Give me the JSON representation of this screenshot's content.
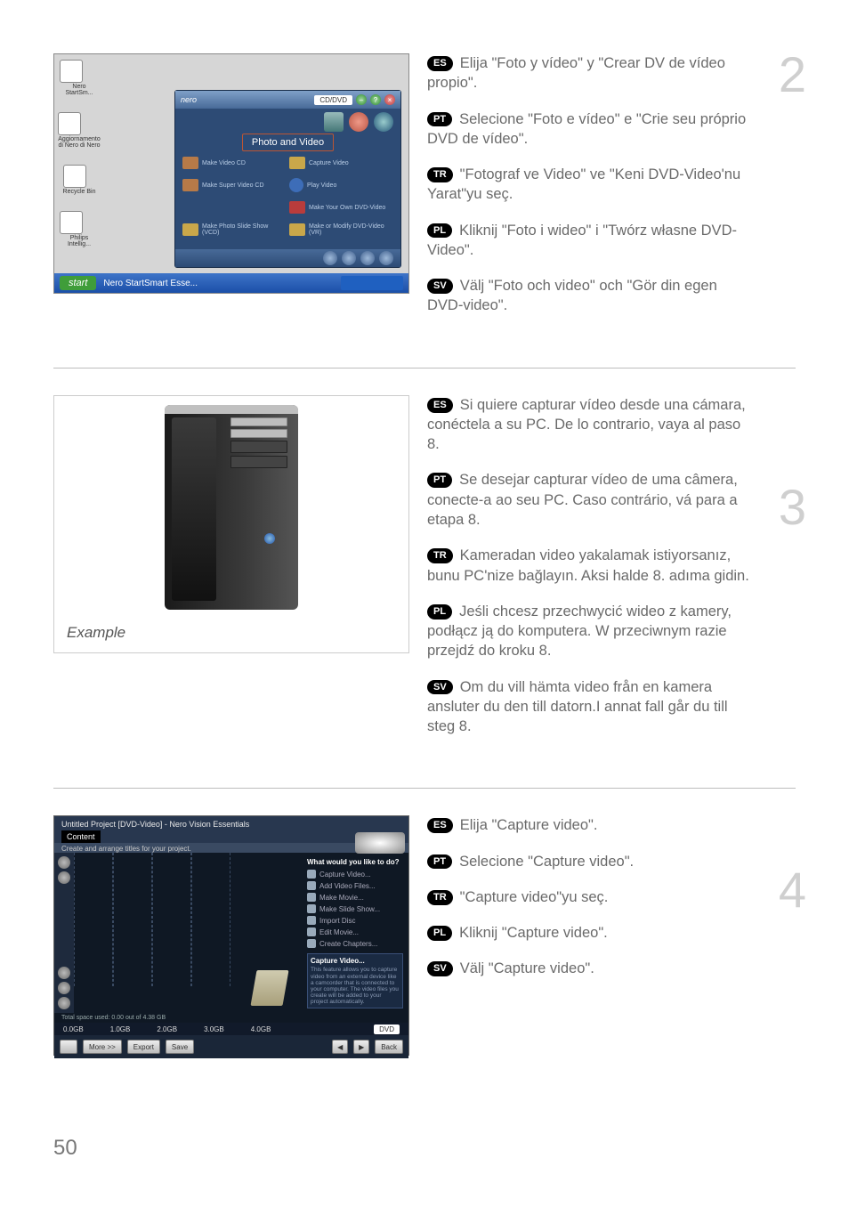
{
  "page_number": "50",
  "steps": {
    "2": {
      "number": "2",
      "es": "Elija \"Foto y vídeo\" y \"Crear DV de vídeo propio\".",
      "pt": "Selecione \"Foto e vídeo\" e \"Crie seu próprio DVD de vídeo\".",
      "tr": "\"Fotograf ve Video\" ve \"Keni DVD-Video'nu Yarat\"yu seç.",
      "pl": "Kliknij \"Foto i wideo\" i \"Twórz własne DVD-Video\".",
      "sv": "Välj \"Foto och video\" och \"Gör din egen DVD-video\".",
      "screenshot": {
        "title": "nero",
        "selector": "CD/DVD",
        "category": "Photo and Video",
        "desktop_icons": [
          "Nero StartSm...",
          "Aggiornamento di Nero di Nero",
          "Recycle Bin",
          "Philips Intellig..."
        ],
        "grid": [
          "Make Video CD",
          "Capture Video",
          "Make Super Video CD",
          "Play Video",
          "",
          "Make Your Own DVD-Video",
          "Make Photo Slide Show (VCD)",
          "Make or Modify DVD-Video (VR)"
        ],
        "taskbar_start": "start",
        "taskbar_label": "Nero StartSmart Esse..."
      }
    },
    "3": {
      "number": "3",
      "es": "Si quiere capturar vídeo desde una cámara, conéctela a su PC. De lo contrario, vaya al paso 8.",
      "pt": "Se desejar capturar vídeo de uma câmera, conecte-a ao seu PC. Caso contrário, vá para a etapa 8.",
      "tr": "Kameradan video yakalamak istiyorsanız, bunu PC'nize bağlayın. Aksi halde 8. adıma gidin.",
      "pl": "Jeśli chcesz przechwycić wideo z kamery, podłącz ją do komputera. W przeciwnym razie przejdź do kroku 8.",
      "sv": "Om du vill hämta video från en kamera ansluter du den till datorn.I annat fall går du till steg 8.",
      "example_label": "Example"
    },
    "4": {
      "number": "4",
      "es": "Elija \"Capture video\".",
      "pt": "Selecione \"Capture video\".",
      "tr": "\"Capture video\"yu seç.",
      "pl": "Kliknij \"Capture video\".",
      "sv": "Välj \"Capture video\".",
      "screenshot": {
        "window_title": "Untitled Project [DVD-Video] - Nero Vision Essentials",
        "section": "Content",
        "section_desc": "Create and arrange titles for your project.",
        "right_q": "What would you like to do?",
        "right_items": [
          "Capture Video...",
          "Add Video Files...",
          "Make Movie...",
          "Make Slide Show...",
          "Import Disc",
          "Edit Movie...",
          "Create Chapters..."
        ],
        "capture_title": "Capture Video...",
        "capture_desc": "This feature allows you to capture video from an external device like a camcorder that is connected to your computer. The video files you create will be added to your project automatically.",
        "space": "Total space used: 0.00 out of 4.38 GB",
        "ticks": [
          "0.0GB",
          "1.0GB",
          "2.0GB",
          "3.0GB",
          "4.0GB"
        ],
        "footer": [
          "More >>",
          "Export",
          "Save",
          "Back"
        ],
        "disc_label": "DVD"
      }
    }
  },
  "labels": {
    "es": "ES",
    "pt": "PT",
    "tr": "TR",
    "pl": "PL",
    "sv": "SV"
  }
}
